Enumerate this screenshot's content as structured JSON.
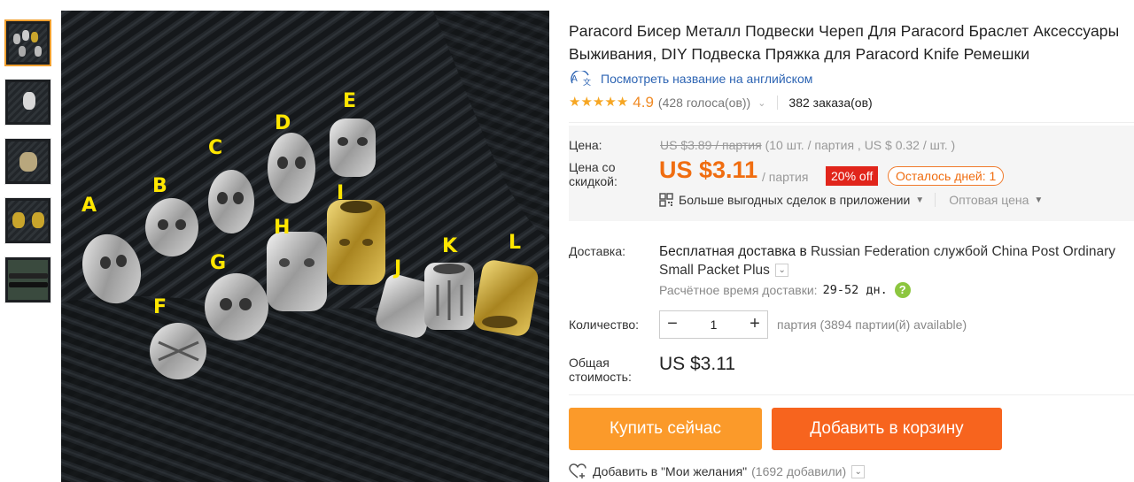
{
  "thumbnails": [
    {
      "name": "thumb-1",
      "active": true
    },
    {
      "name": "thumb-2",
      "active": false
    },
    {
      "name": "thumb-3",
      "active": false
    },
    {
      "name": "thumb-4",
      "active": false
    },
    {
      "name": "thumb-5",
      "active": false
    }
  ],
  "image": {
    "letters": [
      "A",
      "B",
      "C",
      "D",
      "E",
      "F",
      "G",
      "H",
      "I",
      "J",
      "K",
      "L"
    ]
  },
  "product": {
    "title": "Paracord Бисер Металл Подвески Череп Для Paracord Браслет Аксессуары Выживания, DIY Подвеска Пряжка для Paracord Knife Ремешки",
    "translate_link": "Посмотреть название на английском",
    "rating": "4.9",
    "votes": "(428 голоса(ов))",
    "orders": "382 заказа(ов)"
  },
  "price": {
    "label": "Цена:",
    "old": "US $3.89 / партия",
    "old_detail": "(10 шт. / партия , US $ 0.32 / шт. )",
    "discount_label": "Цена со скидкой:",
    "new": "US $3.11",
    "per_lot": "/ партия",
    "off_badge": "20% off",
    "days_left": "Осталось дней: 1",
    "app_deals": "Больше выгодных сделок в приложении",
    "wholesale": "Оптовая цена"
  },
  "shipping": {
    "label": "Доставка:",
    "prefix": "Бесплатная доставка в",
    "text": " Russian Federation службой China Post Ordinary Small Packet Plus",
    "eta_label": "Расчётное время доставки:",
    "eta_days": "29-52 дн."
  },
  "quantity": {
    "label": "Количество:",
    "value": "1",
    "minus": "−",
    "plus": "+",
    "available": "партия (3894 партии(й) available)"
  },
  "total": {
    "label": "Общая стоимость:",
    "value": "US $3.11"
  },
  "actions": {
    "buy_now": "Купить сейчас",
    "add_to_cart": "Добавить в корзину",
    "wishlist": "Добавить в \"Мои желания\"",
    "wishlist_count": "(1692 добавили)"
  },
  "colors": {
    "accent_orange": "#f06d10",
    "buy_button": "#fb9a2a",
    "cart_button": "#f7641e",
    "discount_badge": "#e1251b",
    "link_blue": "#2d64b3"
  }
}
